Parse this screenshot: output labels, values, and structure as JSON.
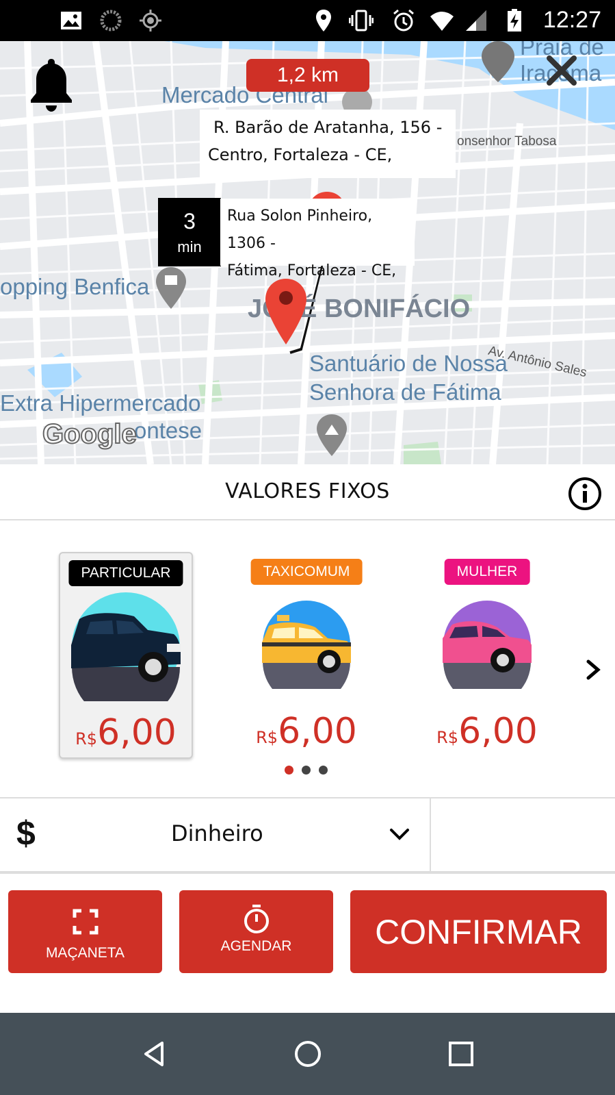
{
  "status_bar": {
    "time": "12:27",
    "icons": [
      "image-icon",
      "sync-icon",
      "gps-icon",
      "location-icon",
      "vibrate-icon",
      "alarm-icon",
      "wifi-icon",
      "signal-icon",
      "battery-charging-icon"
    ]
  },
  "map": {
    "distance": "1,2 km",
    "destination_address": [
      "R. Barão de Aratanha, 156 -",
      "Centro, Fortaleza - CE,"
    ],
    "origin_address": [
      "Rua Solon Pinheiro, 1306 -",
      "Fátima, Fortaleza - CE,"
    ],
    "eta_value": "3",
    "eta_unit": "min",
    "labels": {
      "mercado": "Mercado Central",
      "praia": "Praia de",
      "iracema": "Iracema",
      "monsenhor": "onsenhor Tabosa",
      "shopping": "opping Benfica",
      "bairro": "JOSÉ BONIFÁCIO",
      "santuario1": "Santuário de Nossa",
      "santuario2": "Senhora de Fátima",
      "avenida": "Av. Antônio Sales",
      "extra": "Extra Hipermercado",
      "montese": "ontese"
    },
    "google": "Google",
    "colors": {
      "water": "#aadaff",
      "land": "#e8eaed",
      "road": "#ffffff",
      "pin": "#ea4335"
    }
  },
  "sheet": {
    "title": "VALORES FIXOS"
  },
  "categories": [
    {
      "label": "PARTICULAR",
      "color": "#000000",
      "currency": "R$",
      "price": "6,00",
      "selected": true
    },
    {
      "label": "TAXICOMUM",
      "color": "#f57f17",
      "currency": "R$",
      "price": "6,00",
      "selected": false
    },
    {
      "label": "MULHER",
      "color": "#ec1380",
      "currency": "R$",
      "price": "6,00",
      "selected": false
    }
  ],
  "pagination": {
    "page": 1,
    "total": 3
  },
  "payment": {
    "symbol": "$",
    "method": "Dinheiro"
  },
  "actions": {
    "handle_label": "MAÇANETA",
    "schedule_label": "AGENDAR",
    "confirm_label": "CONFIRMAR"
  },
  "accent_color": "#cf3026"
}
